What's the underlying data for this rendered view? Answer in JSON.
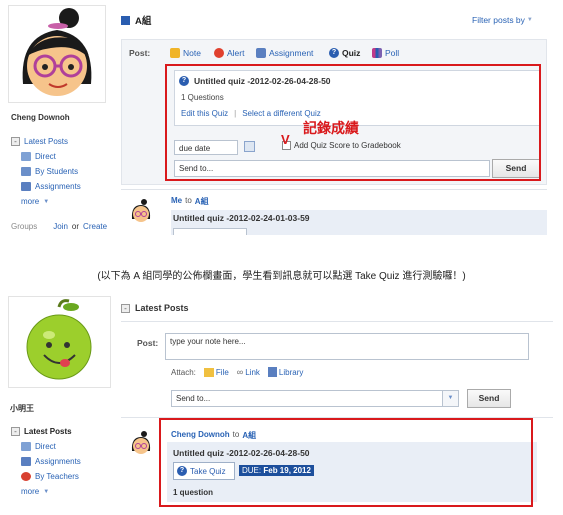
{
  "top": {
    "user_name": "Cheng Downoh",
    "group_title": "A組",
    "filter_label": "Filter posts by",
    "post_label": "Post:",
    "post_types": [
      {
        "label": "Note",
        "icon": "note-icon",
        "color": "#f0b428"
      },
      {
        "label": "Alert",
        "icon": "alert-icon",
        "color": "#e0402e"
      },
      {
        "label": "Assignment",
        "icon": "assignment-icon",
        "color": "#5a7fc0"
      },
      {
        "label": "Quiz",
        "icon": "quiz-icon",
        "color": "#2a5db0"
      },
      {
        "label": "Poll",
        "icon": "poll-icon",
        "color": "#c03a8a"
      }
    ],
    "quiz": {
      "title": "Untitled quiz -2012-02-26-04-28-50",
      "questions": "1 Questions",
      "edit_link": "Edit this Quiz",
      "select_link": "Select a different Quiz"
    },
    "due_date_placeholder": "due date",
    "gradebook_label": "Add Quiz Score to Gradebook",
    "send_to_placeholder": "Send to...",
    "send_button": "Send",
    "annotation_label": "記錄成績",
    "annotation_mark": "V",
    "sidebar": {
      "latest_posts": "Latest Posts",
      "items": [
        "Direct",
        "By Students",
        "Assignments"
      ],
      "more": "more",
      "groups_label": "Groups",
      "join_label": "Join",
      "or_label": "or",
      "create_label": "Create"
    },
    "feed": {
      "sender": "Me",
      "to_word": "to",
      "group": "A組",
      "title": "Untitled quiz -2012-02-24-01-03-59"
    }
  },
  "caption": "(以下為 A 組同學的公佈欄畫面，學生看到訊息就可以點選 Take  Quiz 進行測驗囉！)",
  "bottom": {
    "latest_posts_header": "Latest Posts",
    "user_name": "小明王",
    "post_label": "Post:",
    "note_placeholder": "type your note here...",
    "attach_label": "Attach:",
    "attach_items": [
      {
        "label": "File",
        "icon": "file-icon"
      },
      {
        "label": "Link",
        "icon": "link-icon"
      },
      {
        "label": "Library",
        "icon": "library-icon"
      }
    ],
    "send_to_placeholder": "Send to...",
    "send_button": "Send",
    "sidebar": {
      "latest_posts": "Latest Posts",
      "items": [
        "Direct",
        "Assignments",
        "By Teachers"
      ],
      "more": "more"
    },
    "feed": {
      "sender": "Cheng Downoh",
      "to_word": "to",
      "group": "A組",
      "title": "Untitled quiz -2012-02-26-04-28-50",
      "take_quiz": "Take Quiz",
      "due_prefix": "DUE:",
      "due_date": "Feb 19, 2012",
      "question_count": "1 question"
    }
  }
}
